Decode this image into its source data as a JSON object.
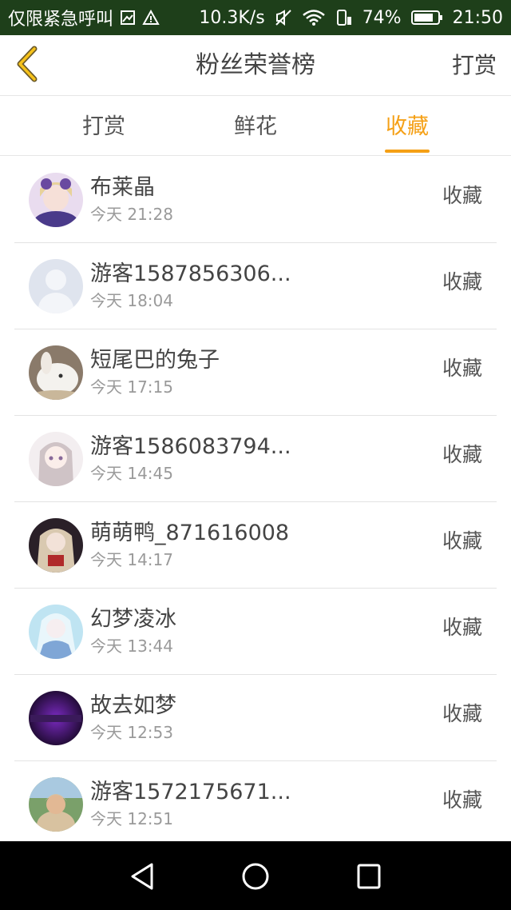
{
  "status_bar": {
    "carrier": "仅限紧急呼叫",
    "speed": "10.3K/s",
    "battery": "74%",
    "time": "21:50"
  },
  "nav": {
    "title": "粉丝荣誉榜",
    "right_action": "打赏"
  },
  "tabs": [
    {
      "label": "打赏",
      "active": false
    },
    {
      "label": "鲜花",
      "active": false
    },
    {
      "label": "收藏",
      "active": true
    }
  ],
  "list": [
    {
      "name": "布莱晶",
      "time": "今天 21:28",
      "action": "收藏"
    },
    {
      "name": "游客1587856306...",
      "time": "今天 18:04",
      "action": "收藏"
    },
    {
      "name": "短尾巴的兔子",
      "time": "今天 17:15",
      "action": "收藏"
    },
    {
      "name": "游客1586083794...",
      "time": "今天 14:45",
      "action": "收藏"
    },
    {
      "name": "萌萌鸭_871616008",
      "time": "今天 14:17",
      "action": "收藏"
    },
    {
      "name": "幻梦凌冰",
      "time": "今天 13:44",
      "action": "收藏"
    },
    {
      "name": "故去如梦",
      "time": "今天 12:53",
      "action": "收藏"
    },
    {
      "name": "游客1572175671...",
      "time": "今天 12:51",
      "action": "收藏"
    }
  ],
  "colors": {
    "accent": "#f5a016",
    "status_bar_bg": "#1e3f1a"
  }
}
